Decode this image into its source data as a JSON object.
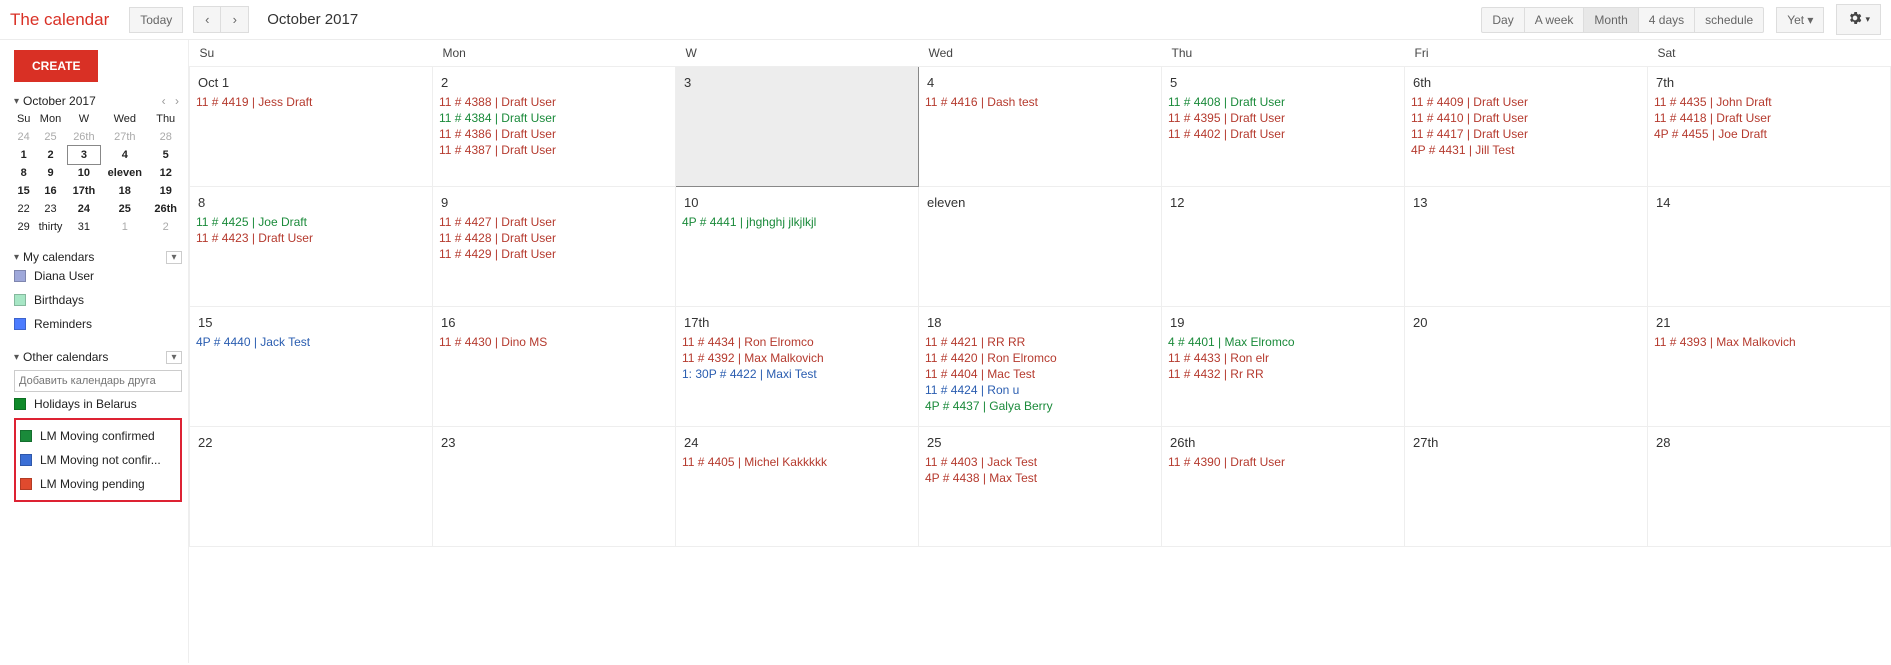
{
  "header": {
    "logo": "The calendar",
    "today": "Today",
    "title": "October 2017",
    "views": [
      "Day",
      "A week",
      "Month",
      "4 days",
      "schedule"
    ],
    "active_view": "Month",
    "more": "Yet ▾"
  },
  "sidebar": {
    "create": "CREATE",
    "month": "October 2017",
    "mini": {
      "dow": [
        "Su",
        "Mon",
        "W",
        "Wed",
        "Thu"
      ],
      "rows": [
        [
          {
            "t": "24",
            "dim": true
          },
          {
            "t": "25",
            "dim": true
          },
          {
            "t": "26th",
            "dim": true
          },
          {
            "t": "27th",
            "dim": true
          },
          {
            "t": "28",
            "dim": true
          }
        ],
        [
          {
            "t": "1",
            "bold": true
          },
          {
            "t": "2",
            "bold": true
          },
          {
            "t": "3",
            "bold": true,
            "sel": true
          },
          {
            "t": "4",
            "bold": true
          },
          {
            "t": "5",
            "bold": true
          }
        ],
        [
          {
            "t": "8",
            "bold": true
          },
          {
            "t": "9",
            "bold": true
          },
          {
            "t": "10",
            "bold": true
          },
          {
            "t": "eleven",
            "bold": true
          },
          {
            "t": "12",
            "bold": true
          }
        ],
        [
          {
            "t": "15",
            "bold": true
          },
          {
            "t": "16",
            "bold": true
          },
          {
            "t": "17th",
            "bold": true
          },
          {
            "t": "18",
            "bold": true
          },
          {
            "t": "19",
            "bold": true
          }
        ],
        [
          {
            "t": "22"
          },
          {
            "t": "23"
          },
          {
            "t": "24",
            "bold": true
          },
          {
            "t": "25",
            "bold": true
          },
          {
            "t": "26th",
            "bold": true
          }
        ],
        [
          {
            "t": "29"
          },
          {
            "t": "thirty"
          },
          {
            "t": "31"
          },
          {
            "t": "1",
            "dim": true
          },
          {
            "t": "2",
            "dim": true
          }
        ]
      ]
    },
    "mycal_h": "My calendars",
    "mycal": [
      {
        "label": "Diana User",
        "color": "#9fa8da"
      },
      {
        "label": "Birthdays",
        "color": "#a7e6c5"
      },
      {
        "label": "Reminders",
        "color": "#4d7cff"
      }
    ],
    "other_h": "Other calendars",
    "add_placeholder": "Добавить календарь друга",
    "other_top": {
      "label": "Holidays in Belarus",
      "color": "#0f8a2a"
    },
    "other_boxed": [
      {
        "label": "LM Moving confirmed",
        "color": "#1a8a3a"
      },
      {
        "label": "LM Moving not confir...",
        "color": "#3b6fd6"
      },
      {
        "label": "LM Moving pending",
        "color": "#e04a2e"
      }
    ]
  },
  "grid": {
    "dow": [
      "Su",
      "Mon",
      "W",
      "Wed",
      "Thu",
      "Fri",
      "Sat"
    ],
    "weeks": [
      [
        {
          "n": "Oct 1",
          "ev": [
            {
              "t": "11  # 4419 | Jess Draft",
              "c": "c-red"
            }
          ]
        },
        {
          "n": "2",
          "ev": [
            {
              "t": "11  # 4388 | Draft User",
              "c": "c-red"
            },
            {
              "t": "11  # 4384 | Draft User",
              "c": "c-green"
            },
            {
              "t": "11  # 4386 | Draft User",
              "c": "c-red"
            },
            {
              "t": "11  # 4387 | Draft User",
              "c": "c-red"
            }
          ]
        },
        {
          "n": "3",
          "sel": true,
          "ev": []
        },
        {
          "n": "4",
          "ev": [
            {
              "t": "11  # 4416 | Dash test",
              "c": "c-red"
            }
          ]
        },
        {
          "n": "5",
          "ev": [
            {
              "t": "11  # 4408 | Draft User",
              "c": "c-green"
            },
            {
              "t": "11  # 4395 | Draft User",
              "c": "c-red"
            },
            {
              "t": "11  # 4402 | Draft User",
              "c": "c-red"
            }
          ]
        },
        {
          "n": "6th",
          "ev": [
            {
              "t": "11  # 4409 | Draft User",
              "c": "c-red"
            },
            {
              "t": "11  # 4410 | Draft User",
              "c": "c-red"
            },
            {
              "t": "11  # 4417 | Draft User",
              "c": "c-red"
            },
            {
              "t": "4P  # 4431 | Jill Test",
              "c": "c-red"
            }
          ]
        },
        {
          "n": "7th",
          "ev": [
            {
              "t": "11  # 4435 | John Draft",
              "c": "c-red"
            },
            {
              "t": "11  # 4418 | Draft User",
              "c": "c-red"
            },
            {
              "t": "4P  # 4455 | Joe Draft",
              "c": "c-red"
            }
          ]
        }
      ],
      [
        {
          "n": "8",
          "ev": [
            {
              "t": "11  # 4425 | Joe Draft",
              "c": "c-green"
            },
            {
              "t": "11  # 4423 | Draft User",
              "c": "c-red"
            }
          ]
        },
        {
          "n": "9",
          "ev": [
            {
              "t": "11  # 4427 | Draft User",
              "c": "c-red"
            },
            {
              "t": "11  # 4428 | Draft User",
              "c": "c-red"
            },
            {
              "t": "11  # 4429 | Draft User",
              "c": "c-red"
            }
          ]
        },
        {
          "n": "10",
          "ev": [
            {
              "t": "4P  # 4441 | jhghghj jlkjlkjl",
              "c": "c-green"
            }
          ]
        },
        {
          "n": "eleven",
          "ev": []
        },
        {
          "n": "12",
          "ev": []
        },
        {
          "n": "13",
          "ev": []
        },
        {
          "n": "14",
          "ev": []
        }
      ],
      [
        {
          "n": "15",
          "ev": [
            {
              "t": "4P  # 4440 | Jack Test",
              "c": "c-blue"
            }
          ]
        },
        {
          "n": "16",
          "ev": [
            {
              "t": "11  # 4430 | Dino MS",
              "c": "c-red"
            }
          ]
        },
        {
          "n": "17th",
          "ev": [
            {
              "t": "11  # 4434 | Ron Elromco",
              "c": "c-red"
            },
            {
              "t": "11  # 4392 | Max Malkovich",
              "c": "c-red"
            },
            {
              "t": "1: 30P  # 4422 | Maxi Test",
              "c": "c-blue"
            }
          ]
        },
        {
          "n": "18",
          "ev": [
            {
              "t": "11  # 4421 | RR RR",
              "c": "c-red"
            },
            {
              "t": "11  # 4420 | Ron Elromco",
              "c": "c-red"
            },
            {
              "t": "11  # 4404 | Mac Test",
              "c": "c-red"
            },
            {
              "t": "11  # 4424 | Ron u",
              "c": "c-blue"
            },
            {
              "t": "4P  # 4437 | Galya Berry",
              "c": "c-green"
            }
          ]
        },
        {
          "n": "19",
          "ev": [
            {
              "t": "4  # 4401 | Max Elromco",
              "c": "c-green"
            },
            {
              "t": "11  # 4433 | Ron elr",
              "c": "c-red"
            },
            {
              "t": "11  # 4432 | Rr RR",
              "c": "c-red"
            }
          ]
        },
        {
          "n": "20",
          "ev": []
        },
        {
          "n": "21",
          "ev": [
            {
              "t": "11  # 4393 | Max Malkovich",
              "c": "c-red"
            }
          ]
        }
      ],
      [
        {
          "n": "22",
          "ev": []
        },
        {
          "n": "23",
          "ev": []
        },
        {
          "n": "24",
          "ev": [
            {
              "t": "11  # 4405 | Michel Kakkkkk",
              "c": "c-red"
            }
          ]
        },
        {
          "n": "25",
          "ev": [
            {
              "t": "11  # 4403 | Jack Test",
              "c": "c-red"
            },
            {
              "t": "4P  # 4438 | Max Test",
              "c": "c-red"
            }
          ]
        },
        {
          "n": "26th",
          "ev": [
            {
              "t": "11  # 4390 | Draft User",
              "c": "c-red"
            }
          ]
        },
        {
          "n": "27th",
          "ev": []
        },
        {
          "n": "28",
          "ev": []
        }
      ]
    ]
  }
}
